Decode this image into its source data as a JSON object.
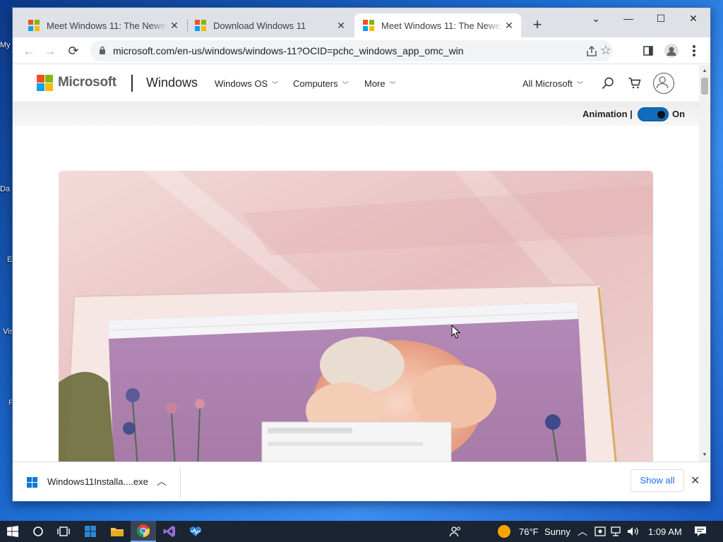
{
  "desktop": {
    "labels": [
      "My",
      "Da",
      "E",
      "Vis",
      "P"
    ]
  },
  "browser": {
    "tabs": [
      {
        "title": "Meet Windows 11: The Newest Windows",
        "close": "✕",
        "active": false
      },
      {
        "title": "Download Windows 11",
        "close": "✕",
        "active": false
      },
      {
        "title": "Meet Windows 11: The Newest Windows",
        "close": "✕",
        "active": true
      }
    ],
    "new_tab": "+",
    "window_controls": {
      "dropdown": "⌄",
      "minimize": "—",
      "maximize": "☐",
      "close": "✕"
    },
    "nav": {
      "back": "←",
      "forward": "→",
      "reload": "⟳"
    },
    "address": {
      "url": "microsoft.com/en-us/windows/windows-11?OCID=pchc_windows_app_omc_win"
    },
    "toolbar_icons": [
      "share-icon",
      "star-icon",
      "side-panel-icon",
      "profile-icon",
      "menu-icon"
    ]
  },
  "site": {
    "brand": "Microsoft",
    "product": "Windows",
    "nav": [
      {
        "label": "Windows OS"
      },
      {
        "label": "Computers"
      },
      {
        "label": "More"
      }
    ],
    "all_microsoft": "All Microsoft",
    "animation_label": "Animation |",
    "animation_state": "On"
  },
  "downloads": {
    "filename": "Windows11Installa....exe",
    "show_all": "Show all",
    "close": "✕"
  },
  "taskbar": {
    "apps": [
      "start",
      "search",
      "task-view",
      "windows-store",
      "file-explorer",
      "chrome",
      "visual-studio",
      "health-app"
    ],
    "weather": {
      "temp": "76°F",
      "condition": "Sunny"
    },
    "time": "1:09 AM"
  },
  "colors": {
    "ms_red": "#f25022",
    "ms_green": "#7fba00",
    "ms_blue": "#00a4ef",
    "ms_yellow": "#ffb900",
    "accent": "#0f6cbd",
    "link": "#1a73e8"
  }
}
